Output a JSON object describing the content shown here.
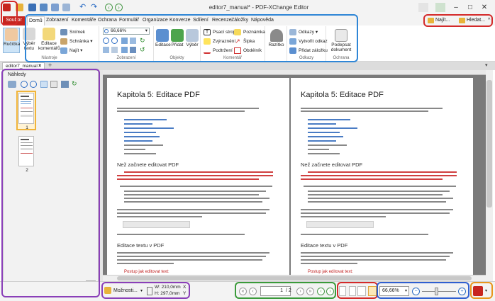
{
  "window": {
    "title": "editor7_manual* - PDF-XChange Editor"
  },
  "menu": {
    "items": [
      "Soubor",
      "Domů",
      "Zobrazení",
      "Komentáře",
      "Ochrana",
      "Formulář",
      "Organizace",
      "Konverze",
      "Sdílení",
      "Recenze",
      "Záložky",
      "Nápověda"
    ]
  },
  "search": {
    "find_label": "Najít...",
    "search_label": "Hledat..."
  },
  "ribbon": {
    "hand": "Ručička",
    "select_text": "Výběr textu",
    "edit_comments": "Editace komentářů",
    "snapshot": "Snímek",
    "clipboard": "Schránka",
    "find": "Najít",
    "group_tools": "Nástroje",
    "zoom_value": "66,66%",
    "group_view": "Zobrazení",
    "editing": "Editace",
    "add": "Přidat",
    "selection": "Výběr",
    "group_objects": "Objekty",
    "typewriter": "Psací stroj",
    "highlight": "Zvýraznění",
    "underline": "Podtržení",
    "note": "Poznámka",
    "arrow": "Šipka",
    "rectangle": "Obdélník",
    "group_comment": "Komentář",
    "stamp": "Razítko",
    "links": "Odkazy",
    "create_link": "Vytvořit odkaz",
    "add_bookmark": "Přidat záložku",
    "group_links": "Odkazy",
    "sign_line1": "Podepsat",
    "sign_line2": "dokument",
    "group_protection": "Ochrana"
  },
  "tab": {
    "name": "editor7_manual *"
  },
  "thumbnails": {
    "title": "Náhledy",
    "page1_label": "1",
    "page2_label": "2"
  },
  "page": {
    "title": "Kapitola 5: Editace PDF",
    "section1": "Než začnete editovat PDF",
    "section2": "Editace textu v PDF",
    "subheading": "Postup jak editovat text:"
  },
  "status": {
    "options": "Možnosti...",
    "width": "W: 210,0mm",
    "height": "H: 297,0mm",
    "x": "X",
    "y": "Y",
    "page_value": "1",
    "page_total": "/ 2",
    "zoom": "66,66%"
  }
}
